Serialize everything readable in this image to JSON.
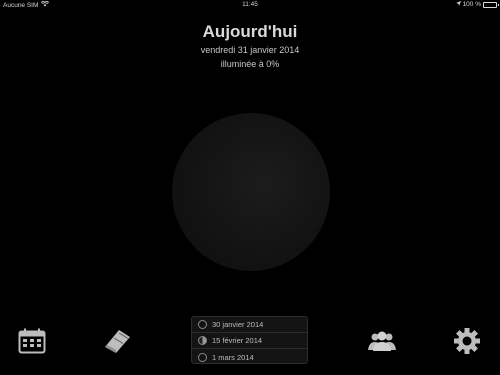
{
  "status_bar": {
    "carrier": "Aucune SIM",
    "time": "11:45",
    "battery_pct": "100 %"
  },
  "header": {
    "title": "Aujourd'hui",
    "date": "vendredi 31 janvier 2014",
    "illumination": "illuminée à 0%"
  },
  "toolbar": {
    "left": [
      {
        "icon": "calendar-icon"
      },
      {
        "icon": "notebook-icon"
      }
    ],
    "right": [
      {
        "icon": "people-icon"
      },
      {
        "icon": "gear-icon"
      }
    ]
  },
  "phases": [
    {
      "label": "30 janvier 2014",
      "icon": "new-moon-icon"
    },
    {
      "label": "15 février 2014",
      "icon": "full-moon-icon"
    },
    {
      "label": "1 mars 2014",
      "icon": "new-moon-icon"
    }
  ],
  "colors": {
    "background": "#000000",
    "text": "#cfcfcf",
    "panel": "#141414"
  }
}
